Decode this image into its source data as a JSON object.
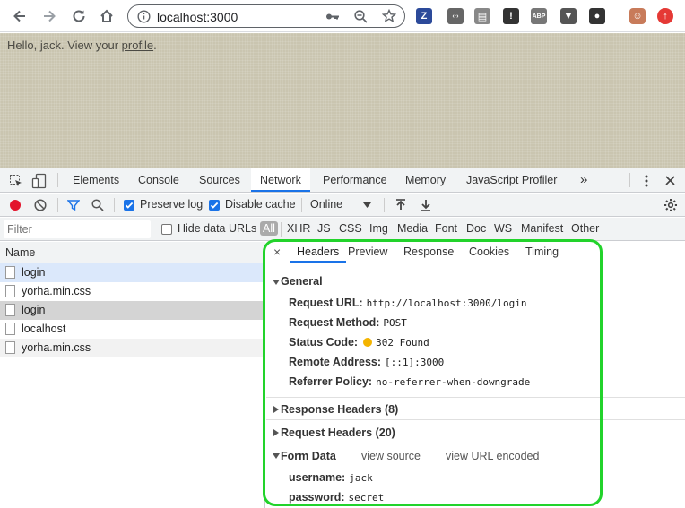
{
  "browser": {
    "url": "localhost:3000",
    "extensions": [
      {
        "icon": "z-icon",
        "glyph": "Z",
        "color": "#2c4a9a"
      },
      {
        "icon": "code-brackets-icon",
        "glyph": "‹·›",
        "color": "#666666"
      },
      {
        "icon": "page-icon",
        "glyph": "▤",
        "color": "#888888"
      },
      {
        "icon": "info-circle-icon",
        "glyph": "!",
        "color": "#333333"
      },
      {
        "icon": "abp-icon",
        "glyph": "ABP",
        "color": "#777777"
      },
      {
        "icon": "vue-icon",
        "glyph": "▼",
        "color": "#555555"
      },
      {
        "icon": "bug-icon",
        "glyph": "●",
        "color": "#333333"
      },
      {
        "icon": "avatar-icon",
        "glyph": "☺",
        "color": "#c87b5a"
      },
      {
        "icon": "upload-icon",
        "glyph": "↑",
        "color": "#e53935"
      }
    ]
  },
  "page": {
    "greeting": "Hello, jack. View your ",
    "profile_link": "profile",
    "period": "."
  },
  "devtools": {
    "tabs": [
      "Elements",
      "Console",
      "Sources",
      "Network",
      "Performance",
      "Memory",
      "JavaScript Profiler"
    ],
    "active_tab": "Network",
    "more": "»",
    "toolbar": {
      "preserve_log": "Preserve log",
      "disable_cache": "Disable cache",
      "throttle": "Online"
    },
    "filter": {
      "placeholder": "Filter",
      "hide_data_urls": "Hide data URLs",
      "types": [
        "All",
        "XHR",
        "JS",
        "CSS",
        "Img",
        "Media",
        "Font",
        "Doc",
        "WS",
        "Manifest",
        "Other"
      ]
    },
    "list": {
      "header": "Name",
      "rows": [
        "login",
        "yorha.min.css",
        "login",
        "localhost",
        "yorha.min.css"
      ]
    },
    "detail": {
      "close": "×",
      "tabs": [
        "Headers",
        "Preview",
        "Response",
        "Cookies",
        "Timing"
      ],
      "general_title": "General",
      "general": [
        {
          "k": "Request URL:",
          "v": "http://localhost:3000/login"
        },
        {
          "k": "Request Method:",
          "v": "POST"
        },
        {
          "k": "Status Code:",
          "v": "302 Found"
        },
        {
          "k": "Remote Address:",
          "v": "[::1]:3000"
        },
        {
          "k": "Referrer Policy:",
          "v": "no-referrer-when-downgrade"
        }
      ],
      "response_headers": "Response Headers (8)",
      "request_headers": "Request Headers (20)",
      "form_data": "Form Data",
      "view_source": "view source",
      "view_url_encoded": "view URL encoded",
      "form": [
        {
          "k": "username:",
          "v": "jack"
        },
        {
          "k": "password:",
          "v": "secret"
        }
      ]
    }
  }
}
